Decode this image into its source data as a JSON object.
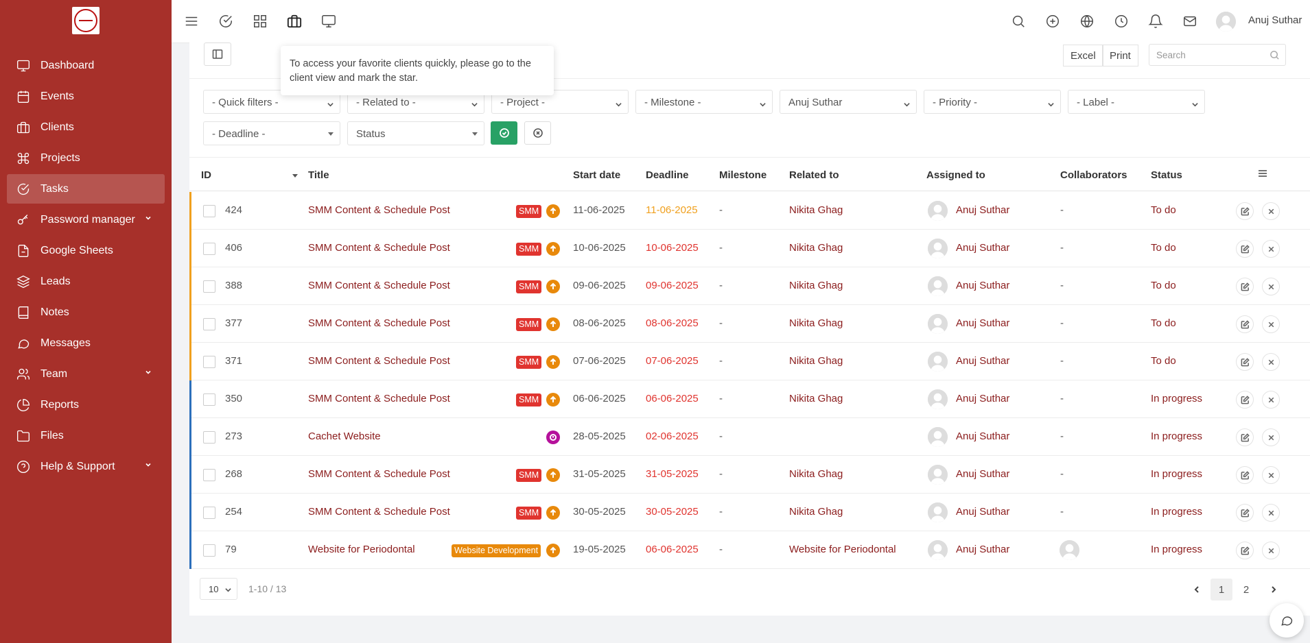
{
  "sidebar": {
    "items": [
      {
        "label": "Dashboard",
        "icon": "monitor-icon"
      },
      {
        "label": "Events",
        "icon": "calendar-icon"
      },
      {
        "label": "Clients",
        "icon": "briefcase-icon"
      },
      {
        "label": "Projects",
        "icon": "command-icon"
      },
      {
        "label": "Tasks",
        "icon": "check-circle-icon",
        "active": true
      },
      {
        "label": "Password manager",
        "icon": "key-icon",
        "has_submenu": true
      },
      {
        "label": "Google Sheets",
        "icon": "file-icon"
      },
      {
        "label": "Leads",
        "icon": "layers-icon"
      },
      {
        "label": "Notes",
        "icon": "book-icon"
      },
      {
        "label": "Messages",
        "icon": "message-icon"
      },
      {
        "label": "Team",
        "icon": "users-icon",
        "has_submenu": true
      },
      {
        "label": "Reports",
        "icon": "pie-chart-icon"
      },
      {
        "label": "Files",
        "icon": "folder-icon"
      },
      {
        "label": "Help & Support",
        "icon": "help-circle-icon",
        "has_submenu": true
      }
    ]
  },
  "topbar": {
    "user_name": "Anuj Suthar"
  },
  "tooltip": {
    "text": "To access your favorite clients quickly, please go to the client view and mark the star."
  },
  "toolbar": {
    "excel": "Excel",
    "print": "Print",
    "search_placeholder": "Search"
  },
  "filters": {
    "quick_filters": "- Quick filters -",
    "related_to": "- Related to -",
    "project": "- Project -",
    "milestone": "- Milestone -",
    "assigned": "Anuj Suthar",
    "priority": "- Priority -",
    "label": "- Label -",
    "deadline": "- Deadline -",
    "status": "Status"
  },
  "table": {
    "headers": {
      "id": "ID",
      "title": "Title",
      "start_date": "Start date",
      "deadline": "Deadline",
      "milestone": "Milestone",
      "related_to": "Related to",
      "assigned_to": "Assigned to",
      "collaborators": "Collaborators",
      "status": "Status"
    },
    "rows": [
      {
        "id": "424",
        "title": "SMM Content & Schedule Post",
        "label": "SMM",
        "start": "11-06-2025",
        "deadline": "11-06-2025",
        "deadline_color": "#f0a01e",
        "milestone": "-",
        "related": "Nikita Ghag",
        "assigned": "Anuj Suthar",
        "collaborators": "-",
        "status": "To do",
        "bar_color": "#f0a01e"
      },
      {
        "id": "406",
        "title": "SMM Content & Schedule Post",
        "label": "SMM",
        "start": "10-06-2025",
        "deadline": "10-06-2025",
        "deadline_color": "#e0342f",
        "milestone": "-",
        "related": "Nikita Ghag",
        "assigned": "Anuj Suthar",
        "collaborators": "-",
        "status": "To do",
        "bar_color": "#f0a01e"
      },
      {
        "id": "388",
        "title": "SMM Content & Schedule Post",
        "label": "SMM",
        "start": "09-06-2025",
        "deadline": "09-06-2025",
        "deadline_color": "#e0342f",
        "milestone": "-",
        "related": "Nikita Ghag",
        "assigned": "Anuj Suthar",
        "collaborators": "-",
        "status": "To do",
        "bar_color": "#f0a01e"
      },
      {
        "id": "377",
        "title": "SMM Content & Schedule Post",
        "label": "SMM",
        "start": "08-06-2025",
        "deadline": "08-06-2025",
        "deadline_color": "#e0342f",
        "milestone": "-",
        "related": "Nikita Ghag",
        "assigned": "Anuj Suthar",
        "collaborators": "-",
        "status": "To do",
        "bar_color": "#f0a01e"
      },
      {
        "id": "371",
        "title": "SMM Content & Schedule Post",
        "label": "SMM",
        "start": "07-06-2025",
        "deadline": "07-06-2025",
        "deadline_color": "#e0342f",
        "milestone": "-",
        "related": "Nikita Ghag",
        "assigned": "Anuj Suthar",
        "collaborators": "-",
        "status": "To do",
        "bar_color": "#f0a01e"
      },
      {
        "id": "350",
        "title": "SMM Content & Schedule Post",
        "label": "SMM",
        "start": "06-06-2025",
        "deadline": "06-06-2025",
        "deadline_color": "#e0342f",
        "milestone": "-",
        "related": "Nikita Ghag",
        "assigned": "Anuj Suthar",
        "collaborators": "-",
        "status": "In progress",
        "bar_color": "#2c6fbb"
      },
      {
        "id": "273",
        "title": "Cachet Website",
        "label": "",
        "start": "28-05-2025",
        "deadline": "02-06-2025",
        "deadline_color": "#e0342f",
        "milestone": "-",
        "related": "",
        "assigned": "Anuj Suthar",
        "collaborators": "-",
        "status": "In progress",
        "bar_color": "#2c6fbb",
        "priority": "purple"
      },
      {
        "id": "268",
        "title": "SMM Content & Schedule Post",
        "label": "SMM",
        "start": "31-05-2025",
        "deadline": "31-05-2025",
        "deadline_color": "#e0342f",
        "milestone": "-",
        "related": "Nikita Ghag",
        "assigned": "Anuj Suthar",
        "collaborators": "-",
        "status": "In progress",
        "bar_color": "#2c6fbb"
      },
      {
        "id": "254",
        "title": "SMM Content & Schedule Post",
        "label": "SMM",
        "start": "30-05-2025",
        "deadline": "30-05-2025",
        "deadline_color": "#e0342f",
        "milestone": "-",
        "related": "Nikita Ghag",
        "assigned": "Anuj Suthar",
        "collaborators": "-",
        "status": "In progress",
        "bar_color": "#2c6fbb"
      },
      {
        "id": "79",
        "title": "Website for Periodontal",
        "label": "Website Development",
        "start": "19-05-2025",
        "deadline": "06-06-2025",
        "deadline_color": "#e0342f",
        "milestone": "-",
        "related": "Website for Periodontal",
        "assigned": "Anuj Suthar",
        "collaborators": "",
        "status": "In progress",
        "bar_color": "#2c6fbb",
        "collab_avatar": true
      }
    ]
  },
  "pagination": {
    "page_size": "10",
    "info": "1-10 / 13",
    "pages": [
      "1",
      "2"
    ]
  },
  "colors": {
    "sidebar": "#a7302a",
    "apply": "#28a165",
    "link": "#8b1c1c"
  }
}
